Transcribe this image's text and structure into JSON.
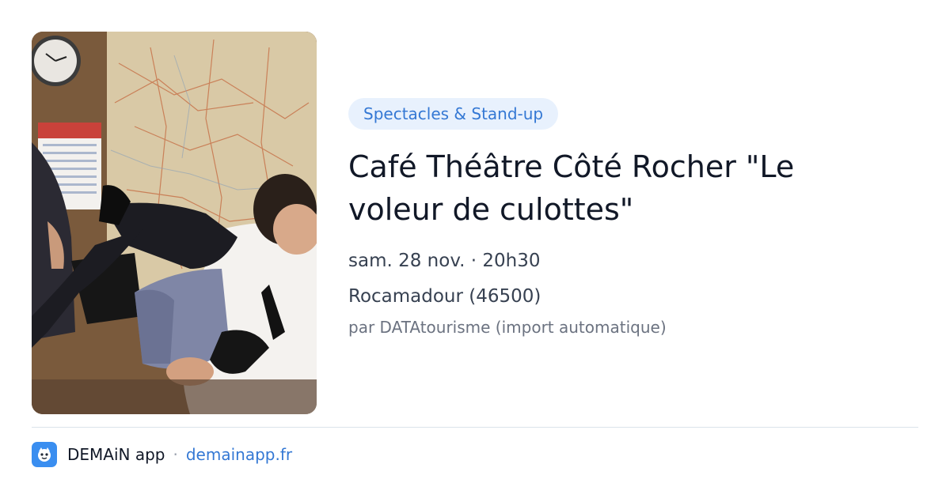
{
  "event": {
    "image_alt": "Photo du spectacle",
    "category": "Spectacles & Stand-up",
    "title": "Café Théâtre Côté Rocher \"Le voleur de culottes\"",
    "datetime": "sam. 28 nov. · 20h30",
    "location": "Rocamadour (46500)",
    "source": "par DATAtourisme (import automatique)"
  },
  "footer": {
    "app_name": "DEMAiN app",
    "separator": "·",
    "domain": "demainapp.fr",
    "logo_icon": "app-logo-icon"
  },
  "colors": {
    "accent": "#3478d4",
    "chip_bg": "#e8f1fd",
    "logo_bg": "#3a8ef0"
  }
}
